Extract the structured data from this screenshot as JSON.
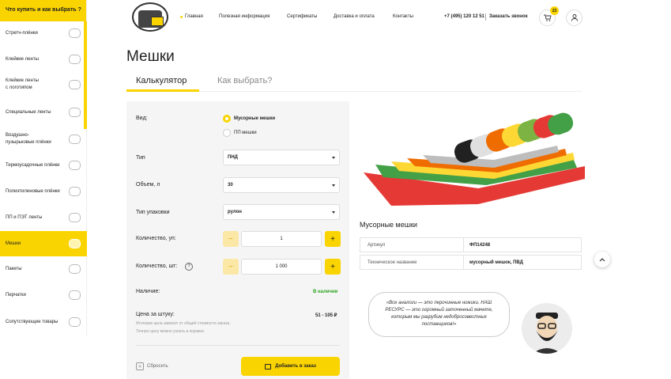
{
  "sidebar": {
    "header": "Что купить и как выбрать ?",
    "items": [
      {
        "label": "Стретч-плёнки",
        "icon": "stretch-film-icon"
      },
      {
        "label": "Клейкие ленты",
        "icon": "tape-icon"
      },
      {
        "label": "Клейкие ленты\nс логотипом",
        "icon": "logo-tape-icon"
      },
      {
        "label": "Специальные ленты",
        "icon": "special-tape-icon"
      },
      {
        "label": "Воздушно-\nпузырьковые плёнки",
        "icon": "bubble-wrap-icon"
      },
      {
        "label": "Термоусадочные плёнки",
        "icon": "shrink-film-icon"
      },
      {
        "label": "Полиэтиленовые плёнки",
        "icon": "pe-film-icon"
      },
      {
        "label": "ПП и ПЭТ ленты",
        "icon": "strap-tape-icon"
      },
      {
        "label": "Мешки",
        "icon": "bags-icon"
      },
      {
        "label": "Пакеты",
        "icon": "packets-icon"
      },
      {
        "label": "Перчатки",
        "icon": "gloves-icon"
      },
      {
        "label": "Сопутствующие товары",
        "icon": "tools-icon"
      }
    ],
    "active_index": 8
  },
  "header": {
    "nav": [
      "Главная",
      "Полезная информация",
      "Сертификаты",
      "Доставка и оплата",
      "Контакты"
    ],
    "phone": "+7 (495) 120 12 51",
    "callback": "Заказать звонок",
    "cart_count": "23"
  },
  "page": {
    "title": "Мешки",
    "tabs": [
      "Калькулятор",
      "Как выбрать?"
    ]
  },
  "calc": {
    "kind_label": "Вид:",
    "kind_options": [
      "Мусорные мешки",
      "ПП мешки"
    ],
    "type_label": "Тип",
    "type_value": "ПНД",
    "volume_label": "Объем, л",
    "volume_value": "30",
    "pack_label": "Тип упаковки",
    "pack_value": "рулон",
    "qty_pack_label": "Количество, уп:",
    "qty_pack_value": "1",
    "qty_pcs_label": "Количество, шт:",
    "qty_pcs_value": "1 000",
    "help": "?",
    "minus": "−",
    "plus": "+",
    "stock_label": "Наличие:",
    "stock_value": "В наличии",
    "price_label": "Цена за штуку:",
    "price_value": "51 - 105 ₽",
    "note1": "Итоговая цена зависит от общей стоимости заказа.",
    "note2": "Точную цену можно узнать в корзине.",
    "reset": "Сбросить",
    "order": "Добавить в заказ"
  },
  "product": {
    "title": "Мусорные мешки",
    "specs": [
      {
        "key": "Артикул",
        "value": "ФП14248"
      },
      {
        "key": "Техническое название",
        "value": "мусорный мешок, ПВД"
      }
    ],
    "quote": "«Все аналоги — это перочинные ножики. НАШ РЕСУРС — это огромный заточенный мачете, которым мы разрубим недобросовестных поставщиков!»"
  },
  "colors": {
    "accent": "#fad400",
    "stock": "#2da31f"
  }
}
